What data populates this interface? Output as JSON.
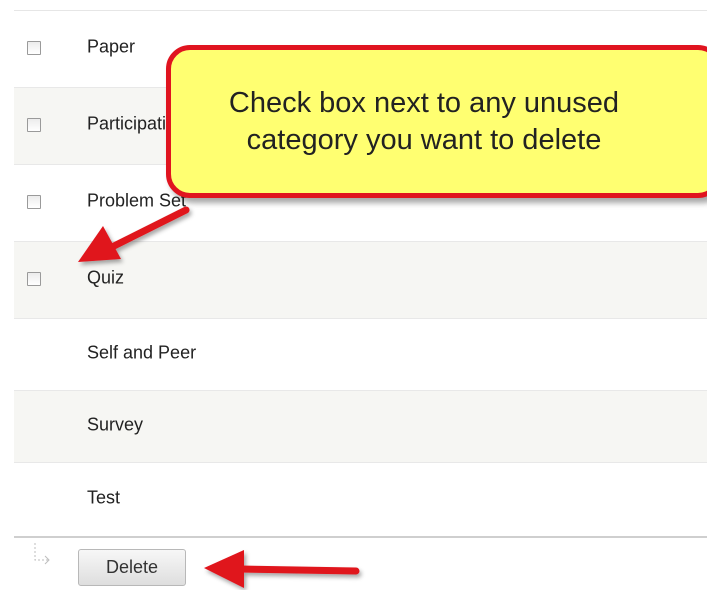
{
  "categories": [
    {
      "label": "Paper",
      "checkbox": true
    },
    {
      "label": "Participation",
      "checkbox": true
    },
    {
      "label": "Problem Set",
      "checkbox": true
    },
    {
      "label": "Quiz",
      "checkbox": true
    },
    {
      "label": "Self and Peer",
      "checkbox": false
    },
    {
      "label": "Survey",
      "checkbox": false
    },
    {
      "label": "Test",
      "checkbox": false
    }
  ],
  "actions": {
    "delete_label": "Delete"
  },
  "callout": {
    "text": "Check box next to any unused category you want to delete"
  },
  "colors": {
    "callout_fill": "#ffff71",
    "callout_border": "#e0141f",
    "arrow": "#e0141f",
    "row_alt": "#f6f6f3"
  }
}
